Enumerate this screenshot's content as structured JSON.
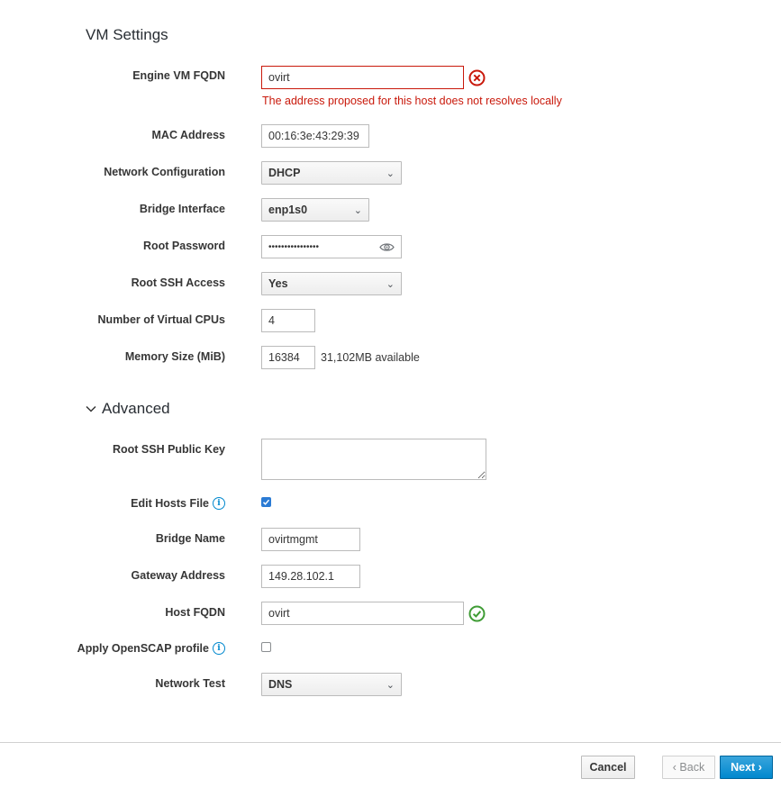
{
  "vm_settings": {
    "title": "VM Settings",
    "engine_fqdn": {
      "label": "Engine VM FQDN",
      "value": "ovirt",
      "error": "The address proposed for this host does not resolves locally"
    },
    "mac_address": {
      "label": "MAC Address",
      "value": "00:16:3e:43:29:39"
    },
    "network_config": {
      "label": "Network Configuration",
      "value": "DHCP"
    },
    "bridge_interface": {
      "label": "Bridge Interface",
      "value": "enp1s0"
    },
    "root_password": {
      "label": "Root Password",
      "value": "••••••••••••••••"
    },
    "root_ssh_access": {
      "label": "Root SSH Access",
      "value": "Yes"
    },
    "vcpus": {
      "label": "Number of Virtual CPUs",
      "value": "4"
    },
    "memory": {
      "label": "Memory Size (MiB)",
      "value": "16384",
      "available": "31,102MB available"
    }
  },
  "advanced": {
    "title": "Advanced",
    "ssh_public_key": {
      "label": "Root SSH Public Key",
      "value": ""
    },
    "edit_hosts_file": {
      "label": "Edit Hosts File",
      "checked": true
    },
    "bridge_name": {
      "label": "Bridge Name",
      "value": "ovirtmgmt"
    },
    "gateway_address": {
      "label": "Gateway Address",
      "value": "149.28.102.1"
    },
    "host_fqdn": {
      "label": "Host FQDN",
      "value": "ovirt"
    },
    "openscap": {
      "label": "Apply OpenSCAP profile",
      "checked": false
    },
    "network_test": {
      "label": "Network Test",
      "value": "DNS"
    }
  },
  "footer": {
    "cancel": "Cancel",
    "back": "‹ Back",
    "next": "Next ›"
  },
  "colors": {
    "error": "#c9190b",
    "success": "#3f9c35",
    "info": "#0088ce",
    "primary": "#0088ce"
  }
}
